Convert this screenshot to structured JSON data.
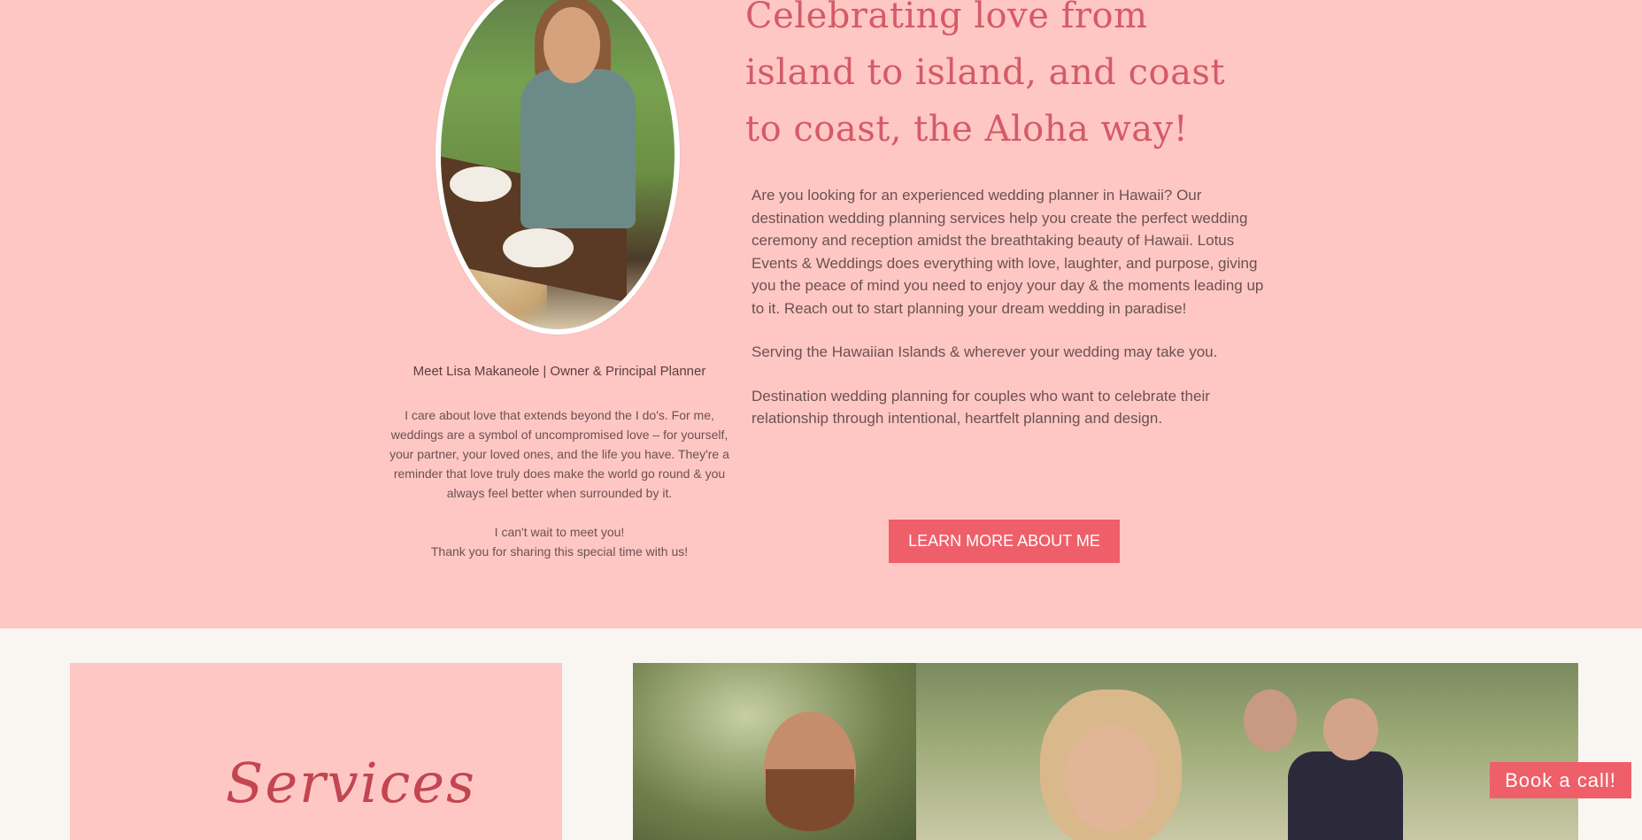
{
  "about": {
    "heading": "Celebrating love from island to island, and coast to coast, the Aloha way!",
    "paragraphs": [
      "Are you looking for an experienced wedding planner in Hawaii? Our destination wedding planning services help you create the perfect wedding ceremony and reception amidst the breathtaking beauty of Hawaii. Lotus Events & Weddings does everything with love, laughter, and purpose, giving you the peace of mind you need to enjoy your day & the moments leading up to it. Reach out to start planning your dream wedding in paradise!",
      "Serving the Hawaiian Islands & wherever your wedding may take you.",
      "Destination wedding planning for couples who want to celebrate their relationship through intentional, heartfelt planning and design."
    ],
    "learn_more_label": "LEARN MORE ABOUT ME"
  },
  "owner": {
    "title": "Meet Lisa Makaneole | Owner & Principal Planner",
    "bio": "I care about love that extends beyond the I do's. For me, weddings are a symbol of uncompromised love – for yourself, your partner, your loved ones, and the life you have. They're a reminder that love truly does make the world go round & you always feel better when surrounded by it.",
    "closing_line1": "I can't wait to meet you!",
    "closing_line2": "Thank you for sharing this special time with us!"
  },
  "services": {
    "title": "Services"
  },
  "cta": {
    "book_label": "Book a call!"
  },
  "colors": {
    "section_bg": "#ffc7c4",
    "page_bg": "#f9f6f2",
    "accent": "#ef5f69",
    "heading": "#d45b66"
  }
}
